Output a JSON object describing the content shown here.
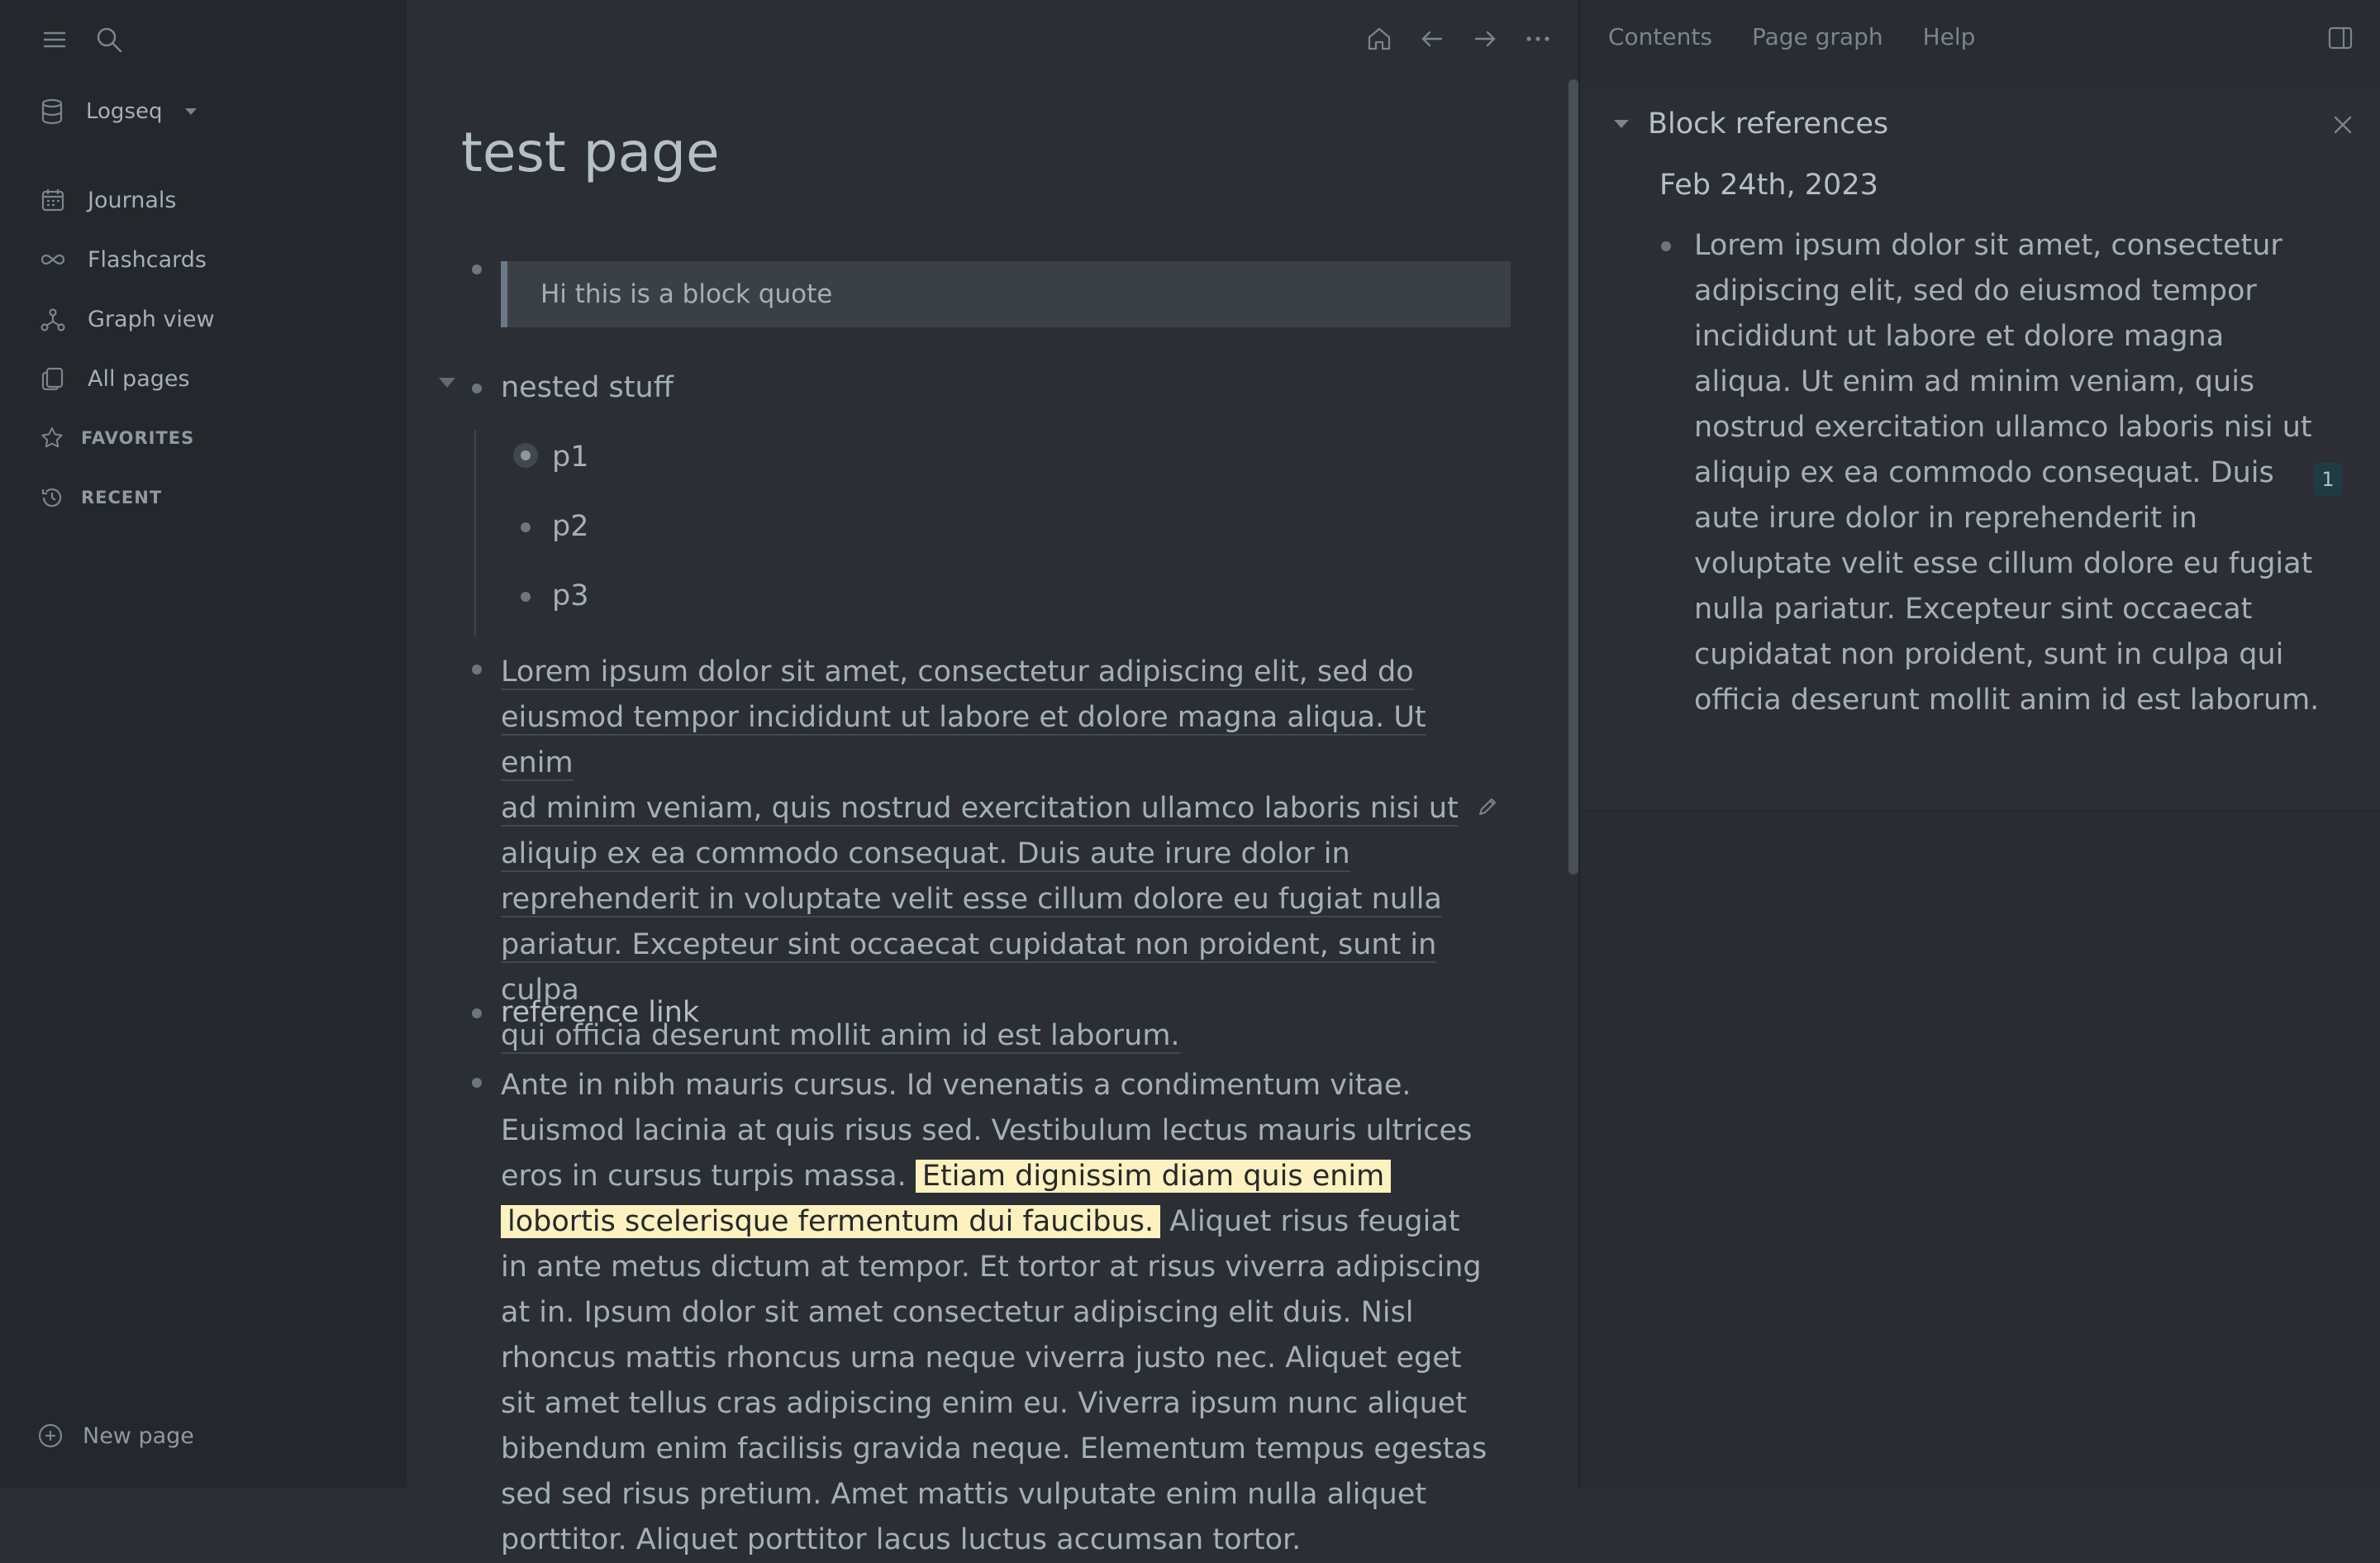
{
  "sidebar": {
    "graph_name": "Logseq",
    "nav": [
      {
        "label": "Journals"
      },
      {
        "label": "Flashcards"
      },
      {
        "label": "Graph view"
      },
      {
        "label": "All pages"
      }
    ],
    "sections": {
      "favorites": "FAVORITES",
      "recent": "RECENT"
    },
    "new_page": "New page"
  },
  "main": {
    "title": "test page",
    "quote": "Hi this is a block quote",
    "nested": {
      "label": "nested stuff",
      "children": [
        "p1",
        "p2",
        "p3"
      ]
    },
    "lorem_block": [
      "Lorem ipsum dolor sit amet, consectetur adipiscing elit, sed do",
      "eiusmod tempor incididunt ut labore et dolore magna aliqua. Ut enim",
      "ad minim veniam, quis nostrud exercitation ullamco laboris nisi ut",
      "aliquip ex ea commodo consequat. Duis aute irure dolor in",
      "reprehenderit in voluptate velit esse cillum dolore eu fugiat nulla",
      "pariatur. Excepteur sint occaecat cupidatat non proident, sunt in culpa",
      "qui officia deserunt mollit anim id est laborum."
    ],
    "reference_link": "reference link",
    "ante": {
      "before": "Ante in nibh mauris cursus. Id venenatis a condimentum vitae. Euismod lacinia at quis risus sed. Vestibulum lectus mauris ultrices eros in cursus turpis massa.",
      "highlight": "Etiam dignissim diam quis enim lobortis scelerisque fermentum dui faucibus.",
      "after": "Aliquet risus feugiat in ante metus dictum at tempor. Et tortor at risus viverra adipiscing at in. Ipsum dolor sit amet consectetur adipiscing elit duis. Nisl rhoncus mattis rhoncus urna neque viverra justo nec. Aliquet eget sit amet tellus cras adipiscing enim eu. Viverra ipsum nunc aliquet bibendum enim facilisis gravida neque. Elementum tempus egestas sed sed risus pretium. Amet mattis vulputate enim nulla aliquet porttitor. Aliquet porttitor lacus luctus accumsan tortor."
    }
  },
  "right_sidebar": {
    "tabs": [
      "Contents",
      "Page graph",
      "Help"
    ],
    "panel_title": "Block references",
    "date": "Feb 24th, 2023",
    "block_text": "Lorem ipsum dolor sit amet, consectetur adipiscing elit, sed do eiusmod tempor incididunt ut labore et dolore magna aliqua. Ut enim ad minim veniam, quis nostrud exercitation ullamco laboris nisi ut aliquip ex ea commodo consequat. Duis aute irure dolor in reprehenderit in voluptate velit esse cillum dolore eu fugiat nulla pariatur. Excepteur sint occaecat cupidatat non proident, sunt in culpa qui officia deserunt mollit anim id est laborum.",
    "ref_count": "1"
  },
  "colors": {
    "background": "#2b2e33",
    "sidebar": "#24272b",
    "highlight": "#fdf2bf",
    "text": "#a4b0b8"
  }
}
